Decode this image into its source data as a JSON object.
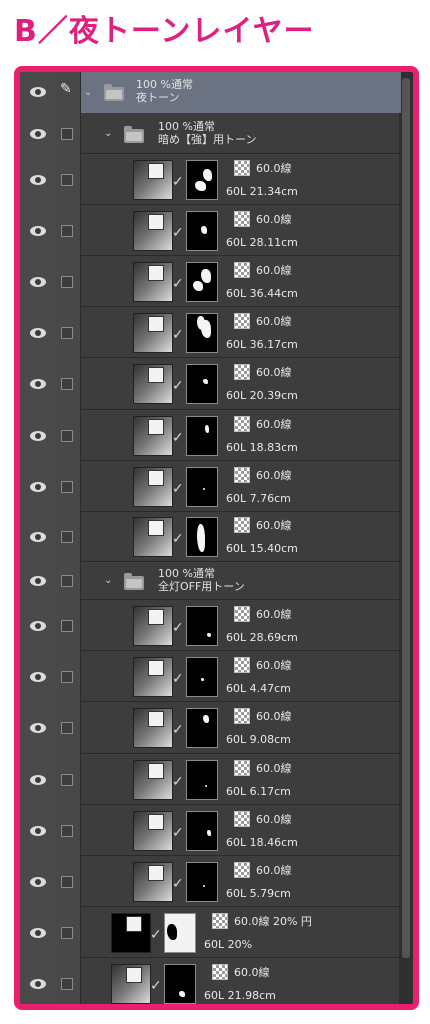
{
  "page_title": "B／夜トーンレイヤー",
  "folders": {
    "root": {
      "blend": "100 %通常",
      "name": "夜トーン"
    },
    "strong": {
      "blend": "100 %通常",
      "name": "暗め【強】用トーン"
    },
    "alloff": {
      "blend": "100 %通常",
      "name": "全灯OFF用トーン"
    }
  },
  "layers": [
    {
      "tone": "60.0線",
      "info": "60L 21.34cm"
    },
    {
      "tone": "60.0線",
      "info": "60L 28.11cm"
    },
    {
      "tone": "60.0線",
      "info": "60L 36.44cm"
    },
    {
      "tone": "60.0線",
      "info": "60L 36.17cm"
    },
    {
      "tone": "60.0線",
      "info": "60L 20.39cm"
    },
    {
      "tone": "60.0線",
      "info": "60L 18.83cm"
    },
    {
      "tone": "60.0線",
      "info": "60L 7.76cm"
    },
    {
      "tone": "60.0線",
      "info": "60L 15.40cm"
    },
    {
      "tone": "60.0線",
      "info": "60L 28.69cm"
    },
    {
      "tone": "60.0線",
      "info": "60L 4.47cm"
    },
    {
      "tone": "60.0線",
      "info": "60L 9.08cm"
    },
    {
      "tone": "60.0線",
      "info": "60L 6.17cm"
    },
    {
      "tone": "60.0線",
      "info": "60L 18.46cm"
    },
    {
      "tone": "60.0線",
      "info": "60L 5.79cm"
    },
    {
      "tone": "60.0線 20% 円",
      "info": "60L 20%"
    },
    {
      "tone": "60.0線",
      "info": "60L 21.98cm"
    }
  ],
  "colors": {
    "accent": "#ea1f6f",
    "title": "#e0207e",
    "panel": "#3d3d3d",
    "selected_folder": "#6b7382"
  }
}
